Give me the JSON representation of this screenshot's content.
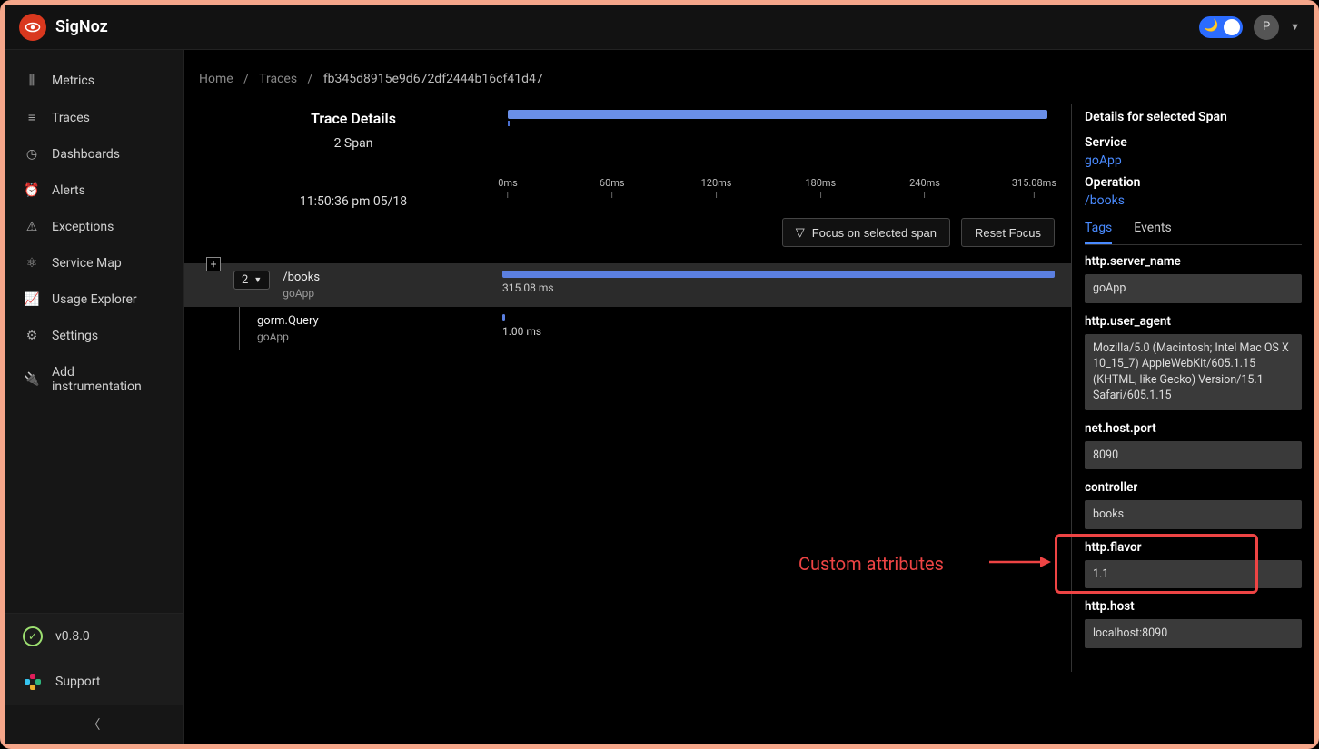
{
  "brand": "SigNoz",
  "avatar_initial": "P",
  "sidebar": {
    "items": [
      {
        "icon": "bars-icon",
        "glyph": "⫼",
        "label": "Metrics"
      },
      {
        "icon": "list-icon",
        "glyph": "≡",
        "label": "Traces"
      },
      {
        "icon": "gauge-icon",
        "glyph": "◷",
        "label": "Dashboards"
      },
      {
        "icon": "bell-icon",
        "glyph": "⏰",
        "label": "Alerts"
      },
      {
        "icon": "warn-icon",
        "glyph": "⚠",
        "label": "Exceptions"
      },
      {
        "icon": "map-icon",
        "glyph": "⚛",
        "label": "Service Map"
      },
      {
        "icon": "chart-icon",
        "glyph": "📈",
        "label": "Usage Explorer"
      },
      {
        "icon": "gear-icon",
        "glyph": "⚙",
        "label": "Settings"
      },
      {
        "icon": "plug-icon",
        "glyph": "🔌",
        "label": "Add instrumentation"
      }
    ],
    "version": "v0.8.0",
    "support": "Support"
  },
  "breadcrumb": {
    "home": "Home",
    "traces": "Traces",
    "id": "fb345d8915e9d672df2444b16cf41d47"
  },
  "trace": {
    "title": "Trace Details",
    "count": "2 Span",
    "timestamp": "11:50:36 pm 05/18",
    "axis": [
      "0ms",
      "60ms",
      "120ms",
      "180ms",
      "240ms",
      "315.08ms"
    ],
    "focus_btn": "Focus on selected span",
    "reset_btn": "Reset Focus",
    "expand_count": "2",
    "spans": [
      {
        "name": "/books",
        "service": "goApp",
        "duration": "315.08 ms",
        "full": true
      },
      {
        "name": "gorm.Query",
        "service": "goApp",
        "duration": "1.00 ms",
        "full": false
      }
    ]
  },
  "details": {
    "header": "Details for selected Span",
    "service_label": "Service",
    "service": "goApp",
    "op_label": "Operation",
    "operation": "/books",
    "tabs": {
      "tags": "Tags",
      "events": "Events"
    },
    "tags": [
      {
        "key": "http.server_name",
        "val": "goApp"
      },
      {
        "key": "http.user_agent",
        "val": "Mozilla/5.0 (Macintosh; Intel Mac OS X 10_15_7) AppleWebKit/605.1.15 (KHTML, like Gecko) Version/15.1 Safari/605.1.15"
      },
      {
        "key": "net.host.port",
        "val": "8090"
      },
      {
        "key": "controller",
        "val": "books"
      },
      {
        "key": "http.flavor",
        "val": "1.1"
      },
      {
        "key": "http.host",
        "val": "localhost:8090"
      }
    ]
  },
  "annotation": "Custom attributes"
}
